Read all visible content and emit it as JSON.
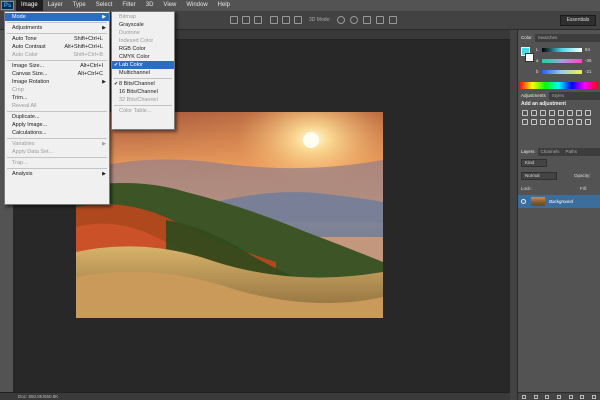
{
  "app": {
    "logo": "Ps"
  },
  "menubar": [
    "Image",
    "Layer",
    "Type",
    "Select",
    "Filter",
    "3D",
    "View",
    "Window",
    "Help"
  ],
  "options_bar": {
    "mode_3d_label": "3D Mode:",
    "workspace": "Essentials"
  },
  "image_menu": [
    {
      "label": "Mode",
      "submenu": true,
      "highlight": true
    },
    {
      "sep": true
    },
    {
      "label": "Adjustments",
      "submenu": true
    },
    {
      "sep": true
    },
    {
      "label": "Auto Tone",
      "shortcut": "Shift+Ctrl+L"
    },
    {
      "label": "Auto Contrast",
      "shortcut": "Alt+Shift+Ctrl+L"
    },
    {
      "label": "Auto Color",
      "shortcut": "Shift+Ctrl+B",
      "disabled": true
    },
    {
      "sep": true
    },
    {
      "label": "Image Size...",
      "shortcut": "Alt+Ctrl+I"
    },
    {
      "label": "Canvas Size...",
      "shortcut": "Alt+Ctrl+C"
    },
    {
      "label": "Image Rotation",
      "submenu": true
    },
    {
      "label": "Crop",
      "disabled": true
    },
    {
      "label": "Trim..."
    },
    {
      "label": "Reveal All",
      "disabled": true
    },
    {
      "sep": true
    },
    {
      "label": "Duplicate..."
    },
    {
      "label": "Apply Image..."
    },
    {
      "label": "Calculations..."
    },
    {
      "sep": true
    },
    {
      "label": "Variables",
      "submenu": true,
      "disabled": true
    },
    {
      "label": "Apply Data Set...",
      "disabled": true
    },
    {
      "sep": true
    },
    {
      "label": "Trap...",
      "disabled": true
    },
    {
      "sep": true
    },
    {
      "label": "Analysis",
      "submenu": true
    }
  ],
  "mode_submenu": [
    {
      "label": "Bitmap",
      "disabled": true
    },
    {
      "label": "Grayscale"
    },
    {
      "label": "Duotone",
      "disabled": true
    },
    {
      "label": "Indexed Color",
      "disabled": true
    },
    {
      "label": "RGB Color"
    },
    {
      "label": "CMYK Color"
    },
    {
      "label": "Lab Color",
      "checked": true,
      "highlight": true
    },
    {
      "label": "Multichannel"
    },
    {
      "sep": true
    },
    {
      "label": "8 Bits/Channel",
      "checked": true
    },
    {
      "label": "16 Bits/Channel"
    },
    {
      "label": "32 Bits/Channel",
      "disabled": true
    },
    {
      "sep": true
    },
    {
      "label": "Color Table...",
      "disabled": true
    }
  ],
  "status_bar": {
    "doc": "Doc: 650.8K/650.8K"
  },
  "panels": {
    "color_tabs": [
      "Color",
      "Swatches"
    ],
    "colors": {
      "foreground": "#48d8e8",
      "background": "#ffffff",
      "selection": "#2c6cc5"
    },
    "sliders": [
      {
        "label": "L",
        "value": "84"
      },
      {
        "label": "a",
        "value": "-36"
      },
      {
        "label": "b",
        "value": "-21"
      }
    ],
    "adjust_tabs": [
      "Adjustments",
      "Styles"
    ],
    "adjust_heading": "Add an adjustment",
    "layers_tabs": [
      "Layers",
      "Channels",
      "Paths"
    ],
    "kind": "Kind",
    "blend_mode": "Normal",
    "opacity_label": "Opacity:",
    "lock_label": "Lock:",
    "fill_label": "Fill:",
    "layer_name": "Background"
  }
}
